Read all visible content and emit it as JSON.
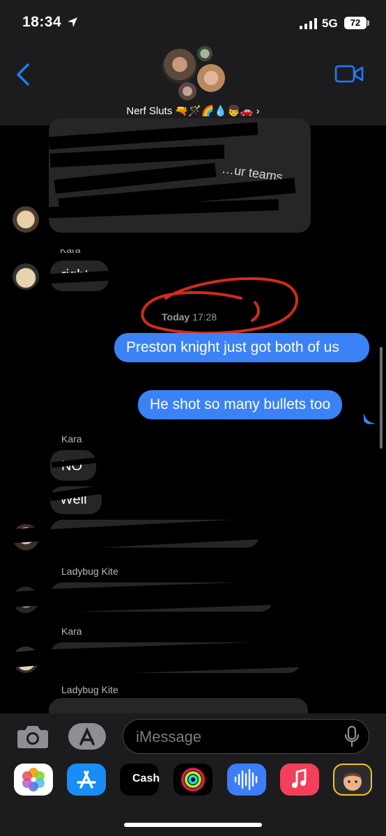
{
  "status": {
    "time": "18:34",
    "network": "5G",
    "battery": "72"
  },
  "header": {
    "group_name": "Nerf Sluts 🔫🪄🌈💧👦🚗 ›"
  },
  "thread": {
    "senders": {
      "kara_1": "Kara",
      "kara_2": "Kara",
      "ladybug_1": "Ladybug  Kite",
      "kara_3": "Kara",
      "ladybug_2": "Ladybug  Kite"
    },
    "incoming_fragments": {
      "block1": "…ur teams",
      "right": "right",
      "no": "NO",
      "well": "Well"
    },
    "timestamp": {
      "day": "Today",
      "time": "17:28"
    },
    "outgoing": [
      "Preston knight just got both of us",
      "He shot so many bullets too"
    ]
  },
  "input": {
    "placeholder": "iMessage"
  },
  "apps": {
    "cash_label": "Cash",
    "items": [
      "photos-icon",
      "app-store-icon",
      "apple-cash-icon",
      "fitness-icon",
      "audio-message-icon",
      "music-icon",
      "memoji-icon"
    ]
  },
  "colors": {
    "outgoing_bubble": "#3b82f6",
    "incoming_bubble": "#262628",
    "header_bg": "#1c1c1e",
    "accent_blue": "#1e7cf7",
    "annotation_red": "#d22b1a"
  }
}
